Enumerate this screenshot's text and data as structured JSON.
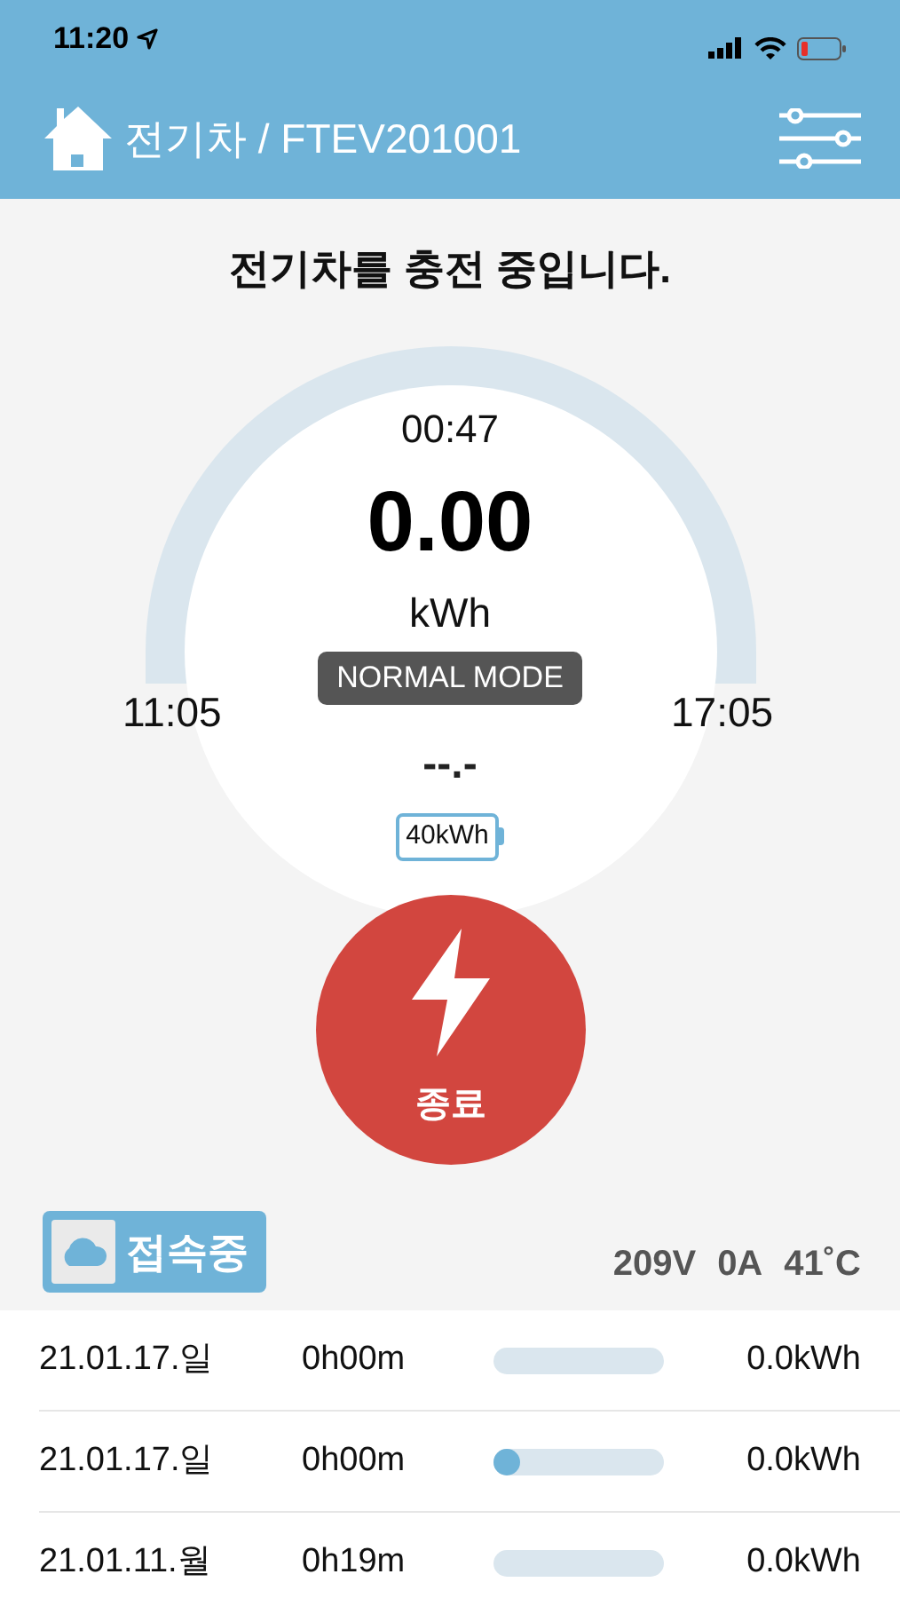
{
  "status_bar": {
    "time": "11:20"
  },
  "header": {
    "title": "전기차 / FTEV201001"
  },
  "status_message": "전기차를 충전 중입니다.",
  "gauge": {
    "elapsed": "00:47",
    "energy": "0.00",
    "unit": "kWh",
    "mode": "NORMAL MODE",
    "start_time": "11:05",
    "end_time": "17:05",
    "rate": "--.-",
    "battery_capacity": "40kWh"
  },
  "stop_button": {
    "label": "종료"
  },
  "connection": {
    "label": "접속중"
  },
  "readings": [
    "209V",
    "0A",
    "41˚C"
  ],
  "history": [
    {
      "date": "21.01.17.일",
      "duration": "0h00m",
      "energy": "0.0kWh"
    },
    {
      "date": "21.01.17.일",
      "duration": "0h00m",
      "level": 0.16,
      "energy": "0.0kWh"
    },
    {
      "date": "21.01.11.월",
      "duration": "0h19m",
      "energy": "0.0kWh"
    }
  ]
}
